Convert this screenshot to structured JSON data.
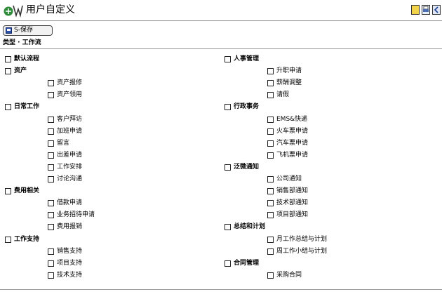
{
  "title": "用户自定义",
  "toolbar": {
    "save_label": "S-保存",
    "icons": [
      "folder-icon",
      "print-icon",
      "back-icon"
    ]
  },
  "breadcrumb": "类型 · 工作流",
  "tree_left": [
    {
      "label": "默认流程",
      "items": []
    },
    {
      "label": "资产",
      "items": [
        "资产报修",
        "资产领用"
      ]
    },
    {
      "label": "日常工作",
      "items": [
        "客户拜访",
        "加班申请",
        "留言",
        "出差申请",
        "工作安排",
        "讨论沟通"
      ]
    },
    {
      "label": "费用相关",
      "items": [
        "借款申请",
        "业务招待申请",
        "费用报销"
      ]
    },
    {
      "label": "工作支持",
      "items": [
        "销售支持",
        "项目支持",
        "技术支持"
      ]
    }
  ],
  "tree_right": [
    {
      "label": "人事管理",
      "items": [
        "升职申请",
        "薪酬调整",
        "请假"
      ]
    },
    {
      "label": "行政事务",
      "items": [
        "EMS&快递",
        "火车票申请",
        "汽车票申请",
        "飞机票申请"
      ]
    },
    {
      "label": "泛微通知",
      "items": [
        "公司通知",
        "销售部通知",
        "技术部通知",
        "项目部通知"
      ]
    },
    {
      "label": "总结和计划",
      "items": [
        "月工作总结与计划",
        "周工作小结与计划"
      ]
    },
    {
      "label": "合同管理",
      "items": [
        "采购合同"
      ]
    }
  ]
}
